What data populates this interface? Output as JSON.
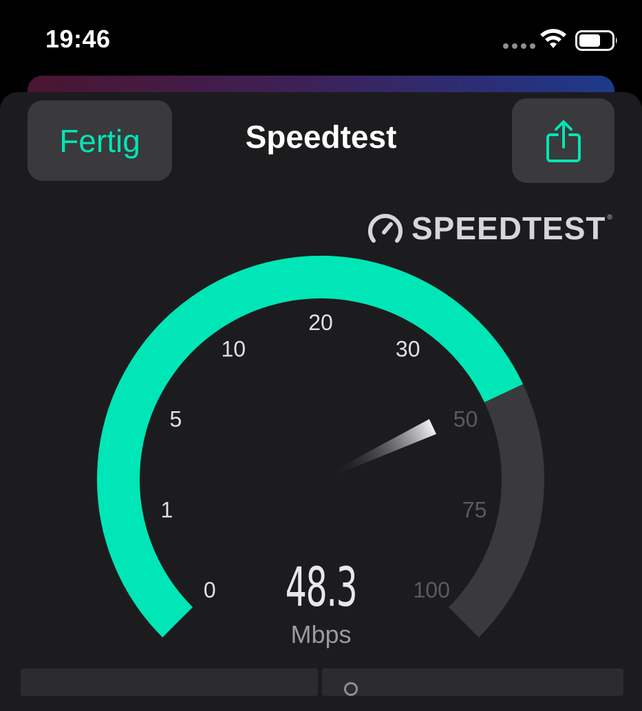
{
  "status_bar": {
    "time": "19:46",
    "icons": [
      "cellular-dots-icon",
      "wifi-icon",
      "battery-icon"
    ]
  },
  "header": {
    "done_label": "Fertig",
    "title": "Speedtest",
    "share_icon": "share-icon"
  },
  "brand": {
    "name": "SPEEDTEST",
    "registered_mark": "®",
    "icon": "speedometer-icon"
  },
  "gauge": {
    "tick_labels": [
      "0",
      "1",
      "5",
      "10",
      "20",
      "30",
      "50",
      "75",
      "100"
    ],
    "current_value": "48.3",
    "unit": "Mbps",
    "progress_fraction": 0.74,
    "needle_fraction": 0.74
  },
  "colors": {
    "accent": "#00e6b6",
    "track": "#3a3a3c",
    "sheet": "#1c1c1e",
    "active_tick": "#e0e0e2",
    "inactive_tick": "#5a5a60"
  }
}
